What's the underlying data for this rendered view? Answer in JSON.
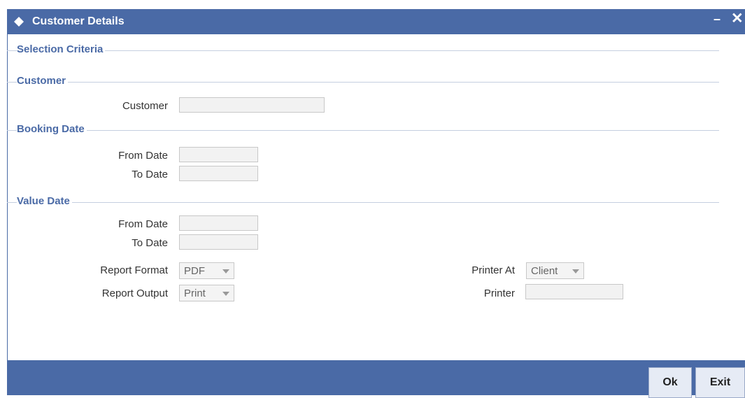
{
  "window": {
    "title": "Customer Details",
    "minimize_glyph": "–",
    "close_glyph": "✕",
    "icon": "diamond-icon",
    "accent_color": "#4a6aa6"
  },
  "sections": {
    "selection_criteria": "Selection Criteria",
    "customer": "Customer",
    "booking_date": "Booking Date",
    "value_date": "Value Date"
  },
  "fields": {
    "customer_label": "Customer",
    "customer_value": "",
    "booking_from_label": "From Date",
    "booking_from_value": "",
    "booking_to_label": "To Date",
    "booking_to_value": "",
    "value_from_label": "From Date",
    "value_from_value": "",
    "value_to_label": "To Date",
    "value_to_value": "",
    "report_format_label": "Report Format",
    "report_format_value": "PDF",
    "report_output_label": "Report Output",
    "report_output_value": "Print",
    "printer_at_label": "Printer At",
    "printer_at_value": "Client",
    "printer_label": "Printer",
    "printer_value": ""
  },
  "buttons": {
    "ok": "Ok",
    "exit": "Exit"
  }
}
